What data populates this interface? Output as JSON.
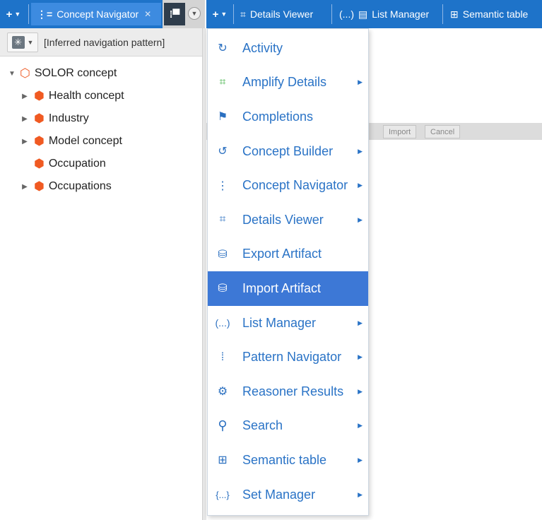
{
  "left_tabbar": {
    "add_icon": "plus-icon",
    "active_tab": {
      "label": "Concept Navigator",
      "icon": "concept-navigator-icon"
    },
    "second_tab_icon": "pattern-navigator-icon"
  },
  "right_tabbar": {
    "add_icon": "plus-icon",
    "tabs": [
      {
        "label": "Details Viewer",
        "icon": "details-viewer-icon",
        "glyph": "⌗"
      },
      {
        "label": "List Manager",
        "prefix": "(...)",
        "icon": "list-manager-icon",
        "glyph": "▤"
      },
      {
        "label": "Semantic table",
        "icon": "semantic-table-icon",
        "glyph": "⊞"
      }
    ]
  },
  "navigator": {
    "pattern_label": "[Inferred navigation pattern]",
    "tree": [
      {
        "label": "SOLOR concept",
        "expanded": true,
        "root": true
      },
      {
        "label": "Health concept",
        "expandable": true
      },
      {
        "label": "Industry",
        "expandable": true
      },
      {
        "label": "Model concept",
        "expandable": true
      },
      {
        "label": "Occupation",
        "expandable": false
      },
      {
        "label": "Occupations",
        "expandable": true
      }
    ]
  },
  "details_panel": {
    "import_button": "Import",
    "cancel_button": "Cancel"
  },
  "menu": {
    "items": [
      {
        "label": "Activity",
        "icon": "activity-icon",
        "glyph": "↻",
        "submenu": false
      },
      {
        "label": "Amplify Details",
        "icon": "amplify-details-icon",
        "glyph": "⌗",
        "submenu": true,
        "icon_color": "green"
      },
      {
        "label": "Completions",
        "icon": "flag-icon",
        "glyph": "⚑",
        "submenu": false
      },
      {
        "label": "Concept Builder",
        "icon": "concept-builder-icon",
        "glyph": "↺",
        "submenu": true
      },
      {
        "label": "Concept Navigator",
        "icon": "concept-navigator-icon",
        "glyph": "⋮",
        "submenu": true
      },
      {
        "label": "Details Viewer",
        "icon": "details-viewer-icon",
        "glyph": "⌗",
        "submenu": true
      },
      {
        "label": "Export Artifact",
        "icon": "export-artifact-icon",
        "glyph": "⛁",
        "submenu": false
      },
      {
        "label": "Import Artifact",
        "icon": "import-artifact-icon",
        "glyph": "⛁",
        "submenu": false,
        "highlighted": true
      },
      {
        "label": "List Manager",
        "icon": "list-manager-icon",
        "glyph": "(...)",
        "submenu": true
      },
      {
        "label": "Pattern Navigator",
        "icon": "pattern-navigator-icon",
        "glyph": "⁞",
        "submenu": true
      },
      {
        "label": "Reasoner Results",
        "icon": "reasoner-results-icon",
        "glyph": "⚙",
        "submenu": true
      },
      {
        "label": "Search",
        "icon": "search-icon",
        "glyph": "⚲",
        "submenu": true
      },
      {
        "label": "Semantic table",
        "icon": "semantic-table-icon",
        "glyph": "⊞",
        "submenu": true
      },
      {
        "label": "Set Manager",
        "icon": "set-manager-icon",
        "glyph": "{...}",
        "submenu": true
      }
    ]
  },
  "colors": {
    "tab_blue": "#1e73c9",
    "menu_text": "#2a73c6",
    "menu_highlight": "#3d78d6",
    "concept_orange": "#f05a22"
  }
}
